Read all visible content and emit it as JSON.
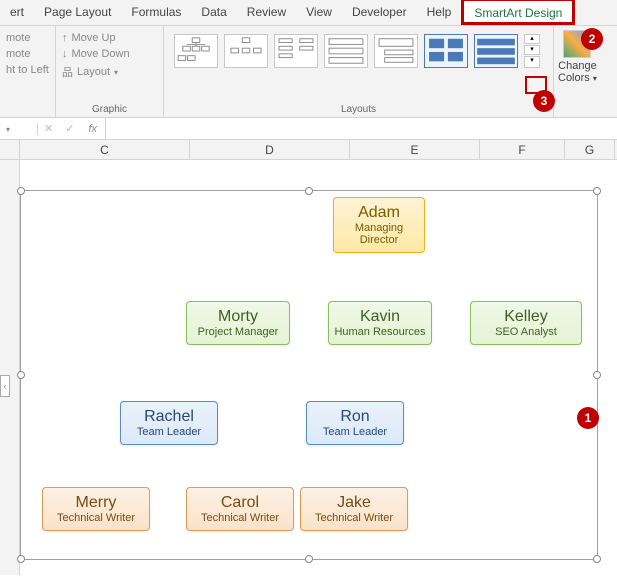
{
  "tabs": {
    "insert": "ert",
    "page_layout": "Page Layout",
    "formulas": "Formulas",
    "data": "Data",
    "review": "Review",
    "view": "View",
    "developer": "Developer",
    "help": "Help",
    "smartart": "SmartArt Design"
  },
  "ribbon": {
    "moveup": "Move Up",
    "movedown": "Move Down",
    "mote1": "mote",
    "mote2": "mote",
    "rtl": "ht to Left",
    "layout": "Layout",
    "graphic_label": "Graphic",
    "layouts_label": "Layouts",
    "change": "Change",
    "colors": "Colors"
  },
  "fbar": {
    "fx": "fx"
  },
  "cols": {
    "C": "C",
    "D": "D",
    "E": "E",
    "F": "F",
    "G": "G"
  },
  "callouts": {
    "c1": "1",
    "c2": "2",
    "c3": "3"
  },
  "org": {
    "adam": {
      "name": "Adam",
      "role": "Managing Director"
    },
    "morty": {
      "name": "Morty",
      "role": "Project Manager"
    },
    "kavin": {
      "name": "Kavin",
      "role": "Human Resources"
    },
    "kelley": {
      "name": "Kelley",
      "role": "SEO Analyst"
    },
    "rachel": {
      "name": "Rachel",
      "role": "Team Leader"
    },
    "ron": {
      "name": "Ron",
      "role": "Team Leader"
    },
    "merry": {
      "name": "Merry",
      "role": "Technical Writer"
    },
    "carol": {
      "name": "Carol",
      "role": "Technical Writer"
    },
    "jake": {
      "name": "Jake",
      "role": "Technical Writer"
    }
  },
  "edge_tab": "‹"
}
